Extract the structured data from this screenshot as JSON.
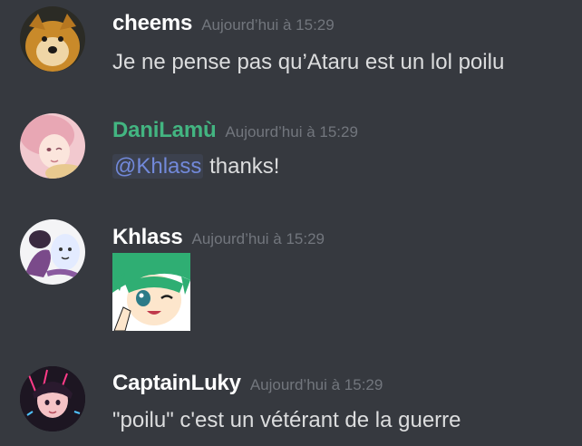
{
  "colors": {
    "background": "#36393f",
    "username_default": "#ffffff",
    "username_danilamu": "#43b581",
    "text": "#dcddde",
    "timestamp": "#72767d",
    "mention": "#7289da"
  },
  "messages": [
    {
      "username": "cheems",
      "timestamp": "Aujourd’hui à 15:29",
      "content": "Je ne pense pas qu’Ataru est un lol poilu",
      "avatar_icon": "cheems-dog-avatar"
    },
    {
      "username": "DaniLamù",
      "timestamp": "Aujourd’hui à 15:29",
      "mention": "@Khlass",
      "content": " thanks!",
      "avatar_icon": "anime-girl-pink-avatar"
    },
    {
      "username": "Khlass",
      "timestamp": "Aujourd’hui à 15:29",
      "attachment": "lum-wink-image",
      "avatar_icon": "ghost-cat-avatar"
    },
    {
      "username": "CaptainLuky",
      "timestamp": "Aujourd’hui à 15:29",
      "content": "\"poilu\" c'est un vétérant de la guerre",
      "avatar_icon": "dark-anime-avatar"
    }
  ]
}
